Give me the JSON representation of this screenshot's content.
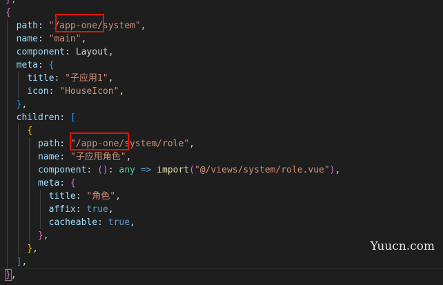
{
  "code": {
    "l0": "},",
    "l1": "{",
    "path_key": "path",
    "path_val": "\"/app-one/system\"",
    "name_key": "name",
    "name_val": "\"main\"",
    "component_key": "component",
    "component_val": "Layout",
    "meta_key": "meta",
    "title_key": "title",
    "title_val": "\"子应用1\"",
    "icon_key": "icon",
    "icon_val": "\"HouseIcon\"",
    "children_key": "children",
    "c_path_key": "path",
    "c_path_val": "\"/app-one/system/role\"",
    "c_name_key": "name",
    "c_name_val": "\"子应用角色\"",
    "c_component_key": "component",
    "c_any": "any",
    "c_import": "import",
    "c_import_path": "\"@/views/system/role.vue\"",
    "c_meta_key": "meta",
    "c_title_key": "title",
    "c_title_val": "\"角色\"",
    "c_affix_key": "affix",
    "c_affix_val": "true",
    "c_cache_key": "cacheable",
    "c_cache_val": "true"
  },
  "watermark": "Yuucn.com"
}
